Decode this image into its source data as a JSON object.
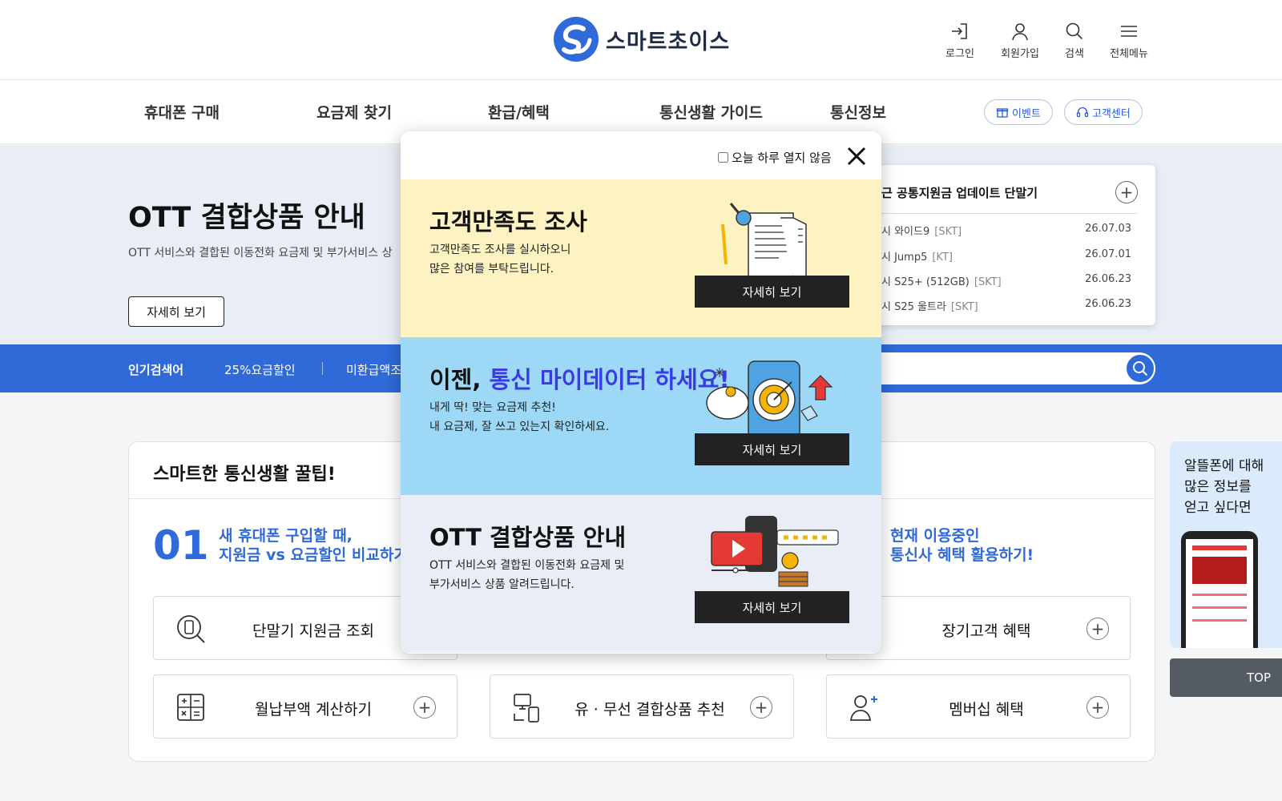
{
  "header": {
    "logo_text": "스마트초이스",
    "util": [
      {
        "label": "로그인",
        "icon": "login-icon"
      },
      {
        "label": "회원가입",
        "icon": "user-icon"
      },
      {
        "label": "검색",
        "icon": "search-icon"
      },
      {
        "label": "전체메뉴",
        "icon": "hamburger-menu-icon"
      }
    ]
  },
  "nav": {
    "items": [
      "휴대폰 구매",
      "요금제 찾기",
      "환급/혜택",
      "통신생활 가이드",
      "통신정보"
    ],
    "event_label": "이벤트",
    "support_label": "고객센터"
  },
  "hero": {
    "title": "OTT 결합상품 안내",
    "desc": "OTT 서비스와 결합된 이동전화 요금제 및 부가서비스 상",
    "button": "자세히 보기"
  },
  "news": {
    "title": "근 공통지원금 업데이트 단말기",
    "items": [
      {
        "name": "시 와이드9",
        "tag": "[SKT]",
        "date": "26.07.03"
      },
      {
        "name": "시 Jump5",
        "tag": "[KT]",
        "date": "26.07.01"
      },
      {
        "name": "시 S25+ (512GB)",
        "tag": "[SKT]",
        "date": "26.06.23"
      },
      {
        "name": "시 S25 울트라",
        "tag": "[SKT]",
        "date": "26.06.23"
      }
    ]
  },
  "band": {
    "label": "인기검색어",
    "keywords": [
      "25%요금할인",
      "미환급액조"
    ]
  },
  "tips": {
    "title": "스마트한 통신생활 꿀팁!",
    "num": "01",
    "head_left": [
      "새 휴대폰 구입할 때,",
      "지원금 vs 요금할인 비교하기"
    ],
    "head_right": [
      "현재 이용중인",
      "통신사 혜택 활용하기!"
    ],
    "cards": {
      "c1": "단말기 지원금 조회",
      "c3": "장기고객 혜택",
      "c4": "월납부액 계산하기",
      "c5": "유 · 무선 결합상품 추천",
      "c6": "멤버십 혜택"
    }
  },
  "side": {
    "text": "알뜰폰에 대해\n많은 정보를\n얻고 싶다면",
    "top_label": "TOP"
  },
  "modal": {
    "no_today": "오늘 하루 열지 않음",
    "panels": [
      {
        "title": "고객만족도 조사",
        "desc": [
          "고객만족도 조사를 실시하오니",
          "많은 참여를 부탁드립니다."
        ],
        "button": "자세히 보기",
        "bg": "#fdf3c2"
      },
      {
        "title_pre": "이젠, ",
        "title_hl": "통신 마이데이터 하세요!",
        "desc": [
          "내게 딱! 맞는 요금제 추천!",
          "내 요금제, 잘 쓰고 있는지 확인하세요."
        ],
        "button": "자세히 보기",
        "bg": "#9dd8f7"
      },
      {
        "title": "OTT 결합상품 안내",
        "desc": [
          "OTT 서비스와 결합된 이동전화 요금제 및",
          "부가서비스 상품 알려드립니다."
        ],
        "button": "자세히 보기",
        "bg": "#e9eef6"
      }
    ]
  }
}
